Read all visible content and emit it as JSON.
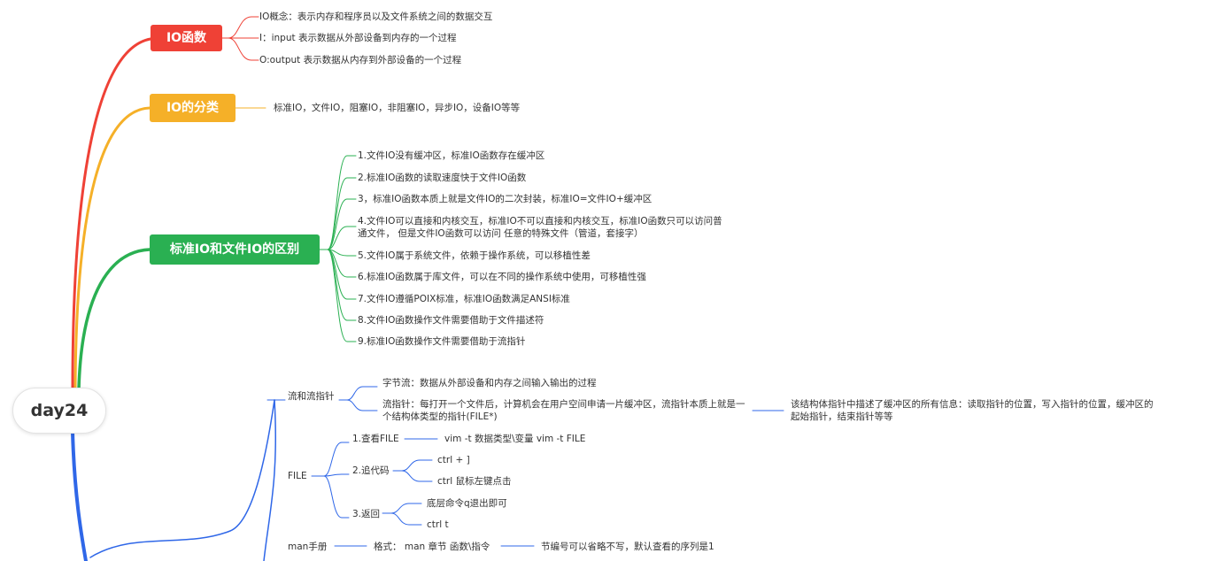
{
  "root": {
    "label": "day24"
  },
  "colors": {
    "red": "#ef4136",
    "orange": "#f5b028",
    "green": "#2ab052",
    "blue": "#2f67e8"
  },
  "branches": {
    "io_func": {
      "label": "IO函数",
      "items": [
        "IO概念：表示内存和程序员以及文件系统之间的数据交互",
        "I：input 表示数据从外部设备到内存的一个过程",
        "O:output 表示数据从内存到外部设备的一个过程"
      ]
    },
    "io_class": {
      "label": "IO的分类",
      "items": [
        "标准IO，文件IO，阻塞IO，非阻塞IO，异步IO，设备IO等等"
      ]
    },
    "io_diff": {
      "label": "标准IO和文件IO的区别",
      "items": [
        "1.文件IO没有缓冲区，标准IO函数存在缓冲区",
        "2.标准IO函数的读取速度快于文件IO函数",
        "3，标准IO函数本质上就是文件IO的二次封装，标准IO=文件IO+缓冲区",
        "4.文件IO可以直接和内核交互，标准IO不可以直接和内核交互，标准IO函数只可以访问普通文件， 但是文件IO函数可以访问 任意的特殊文件（管道，套接字）",
        "5.文件IO属于系统文件，依赖于操作系统，可以移植性差",
        "6.标准IO函数属于库文件，可以在不同的操作系统中使用，可移植性强",
        "7.文件IO遵循POIX标准，标准IO函数满足ANSI标准",
        "8.文件IO函数操作文件需要借助于文件描述符",
        "9.标准IO函数操作文件需要借助于流指针"
      ]
    },
    "blue": {
      "stream": {
        "label": "流和流指针",
        "byte_stream": "字节流：数据从外部设备和内存之间输入输出的过程",
        "stream_ptr": "流指针：每打开一个文件后，计算机会在用户空间申请一片缓冲区，流指针本质上就是一个结构体类型的指针(FILE*)",
        "stream_ptr_note": "该结构体指针中描述了缓冲区的所有信息：读取指针的位置，写入指针的位置，缓冲区的起始指针，结束指针等等"
      },
      "file": {
        "label": "FILE",
        "view": {
          "label": "1.查看FILE",
          "child": "vim -t 数据类型\\变量  vim -t FILE"
        },
        "trace": {
          "label": "2.追代码",
          "children": [
            "ctrl + ]",
            "ctrl 鼠标左键点击"
          ]
        },
        "back": {
          "label": "3.返回",
          "children": [
            "底层命令q退出即可",
            "ctrl t"
          ]
        }
      },
      "man": {
        "label": "man手册",
        "format": "格式： man 章节 函数\\指令",
        "note": "节编号可以省略不写，默认查看的序列是1"
      }
    }
  }
}
